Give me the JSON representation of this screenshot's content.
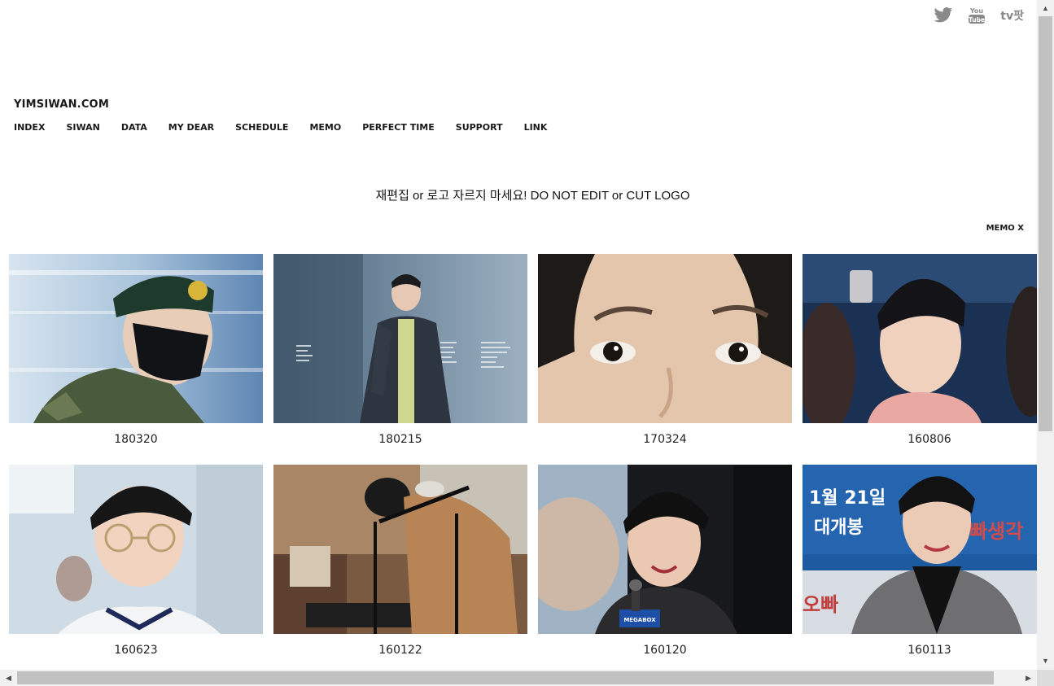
{
  "header": {
    "brand": "YIMSIWAN.COM",
    "social": [
      {
        "name": "twitter-icon"
      },
      {
        "name": "youtube-icon",
        "text_top": "You",
        "text_bottom": "Tube"
      },
      {
        "name": "tvpot-icon",
        "text": "tv팟"
      }
    ],
    "nav": [
      "INDEX",
      "SIWAN",
      "DATA",
      "MY DEAR",
      "SCHEDULE",
      "MEMO",
      "PERFECT TIME",
      "SUPPORT",
      "LINK"
    ]
  },
  "notice": "재편집 or 로고 자르지 마세요! DO NOT EDIT or CUT LOGO",
  "memo_close": "MEMO X",
  "gallery": [
    {
      "caption": "180320",
      "accent": "#3b5b78"
    },
    {
      "caption": "180215",
      "accent": "#5d7487"
    },
    {
      "caption": "170324",
      "accent": "#d7b79a"
    },
    {
      "caption": "160806",
      "accent": "#2f4f77"
    },
    {
      "caption": "160623",
      "accent": "#c9d7df"
    },
    {
      "caption": "160122",
      "accent": "#8b6a4e"
    },
    {
      "caption": "160120",
      "accent": "#2a2d33"
    },
    {
      "caption": "160113",
      "accent": "#204e86",
      "poster_line1": "1월 21일",
      "poster_line2": "대개봉",
      "poster_side1": "빠생각",
      "poster_side2": "오빠"
    }
  ],
  "colors": {
    "text": "#1a1a1a",
    "scrollbar": "#c1c1c1"
  }
}
